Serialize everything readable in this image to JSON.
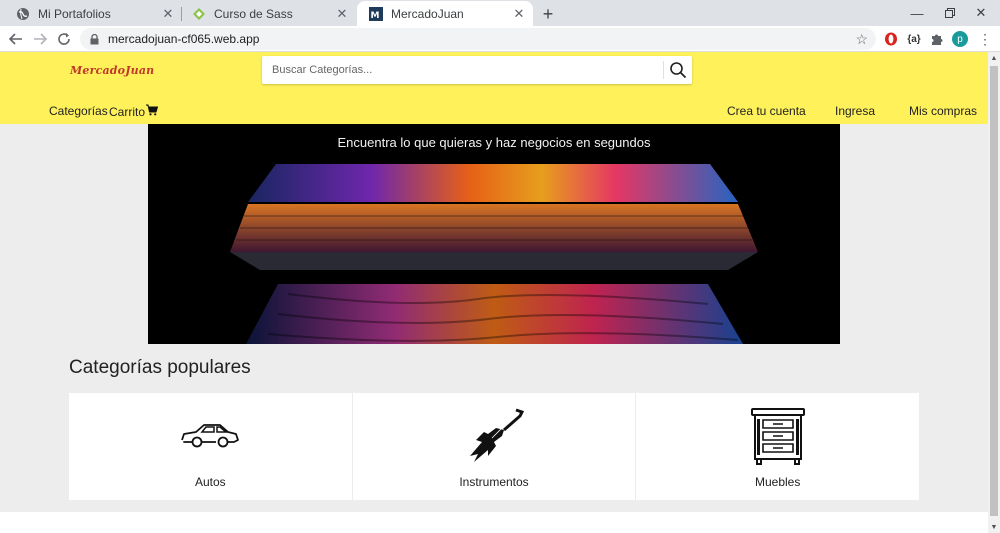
{
  "browser": {
    "tabs": [
      {
        "title": "Mi Portafolios",
        "icon": "globe-icon"
      },
      {
        "title": "Curso de Sass",
        "icon": "diamond-icon"
      },
      {
        "title": "MercadoJuan",
        "icon": "mj-favicon"
      }
    ],
    "new_tab": "+",
    "url": "mercadojuan-cf065.web.app",
    "profile_initial": "p",
    "extension_label": "{a}"
  },
  "site": {
    "logo": "MercadoJuan",
    "search": {
      "placeholder": "Buscar Categorías..."
    },
    "nav_left": {
      "categorias": "Categorías",
      "carrito": "Carrito"
    },
    "nav_right": {
      "crear_cuenta": "Crea tu cuenta",
      "ingresa": "Ingresa",
      "mis_compras": "Mis compras"
    },
    "banner_caption": "Encuentra lo que quieras y haz negocios en segundos",
    "categories_title": "Categorías populares",
    "categories": [
      {
        "label": "Autos",
        "icon": "car-icon"
      },
      {
        "label": "Instrumentos",
        "icon": "guitar-icon"
      },
      {
        "label": "Muebles",
        "icon": "dresser-icon"
      }
    ]
  },
  "colors": {
    "header_bg": "#fff159",
    "page_bg": "#ededed",
    "logo": "#c0392b"
  }
}
